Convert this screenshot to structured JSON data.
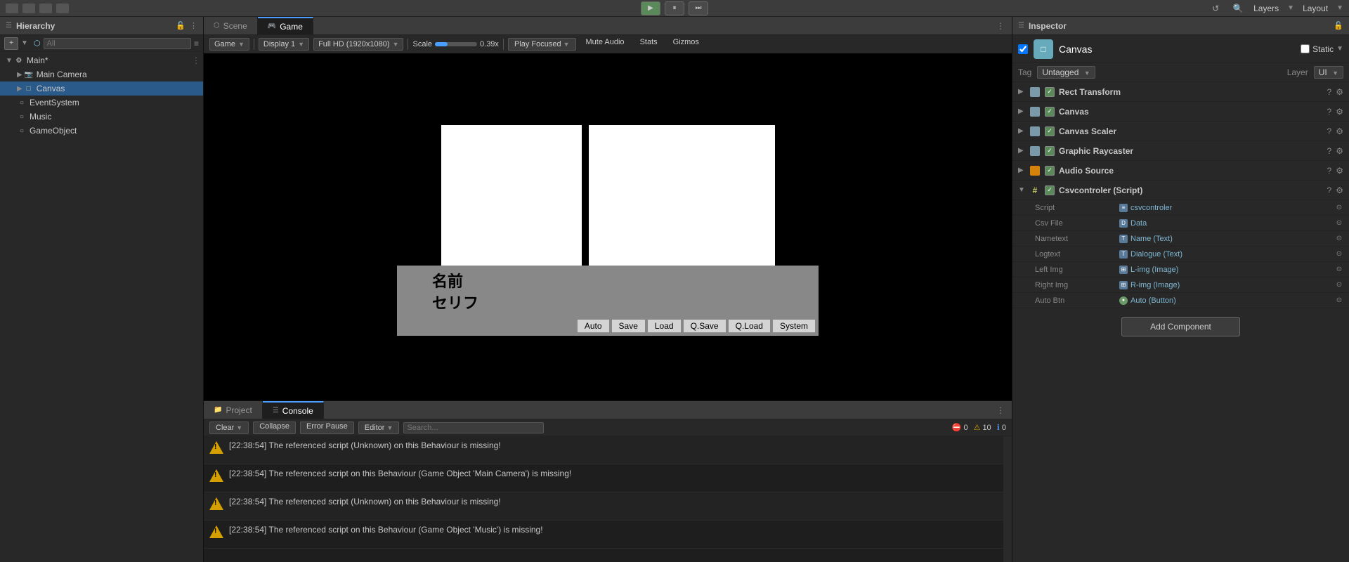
{
  "topbar": {
    "layers_label": "Layers",
    "layout_label": "Layout"
  },
  "playctrls": {
    "play": "▶",
    "pause": "⏸",
    "step": "⏭"
  },
  "hierarchy": {
    "title": "Hierarchy",
    "search_placeholder": "All",
    "root_name": "Main*",
    "items": [
      {
        "label": "Main Camera",
        "type": "camera",
        "depth": 1
      },
      {
        "label": "Canvas",
        "type": "canvas",
        "depth": 1
      },
      {
        "label": "EventSystem",
        "type": "obj",
        "depth": 1
      },
      {
        "label": "Music",
        "type": "obj",
        "depth": 1
      },
      {
        "label": "GameObject",
        "type": "obj",
        "depth": 1
      }
    ]
  },
  "scene_tabs": [
    {
      "label": "Scene",
      "active": false
    },
    {
      "label": "Game",
      "active": true
    }
  ],
  "game_toolbar": {
    "game_label": "Game",
    "display_label": "Display 1",
    "resolution_label": "Full HD (1920x1080)",
    "scale_label": "Scale",
    "scale_value": "0.39x",
    "play_focused_label": "Play Focused",
    "mute_audio_label": "Mute Audio",
    "stats_label": "Stats",
    "gizmos_label": "Gizmos"
  },
  "game_viewport": {
    "dialog_name": "名前",
    "dialog_serif": "セリフ",
    "buttons": [
      "Auto",
      "Save",
      "Load",
      "Q.Save",
      "Q.Load",
      "System"
    ]
  },
  "console": {
    "project_tab": "Project",
    "console_tab": "Console",
    "clear_label": "Clear",
    "collapse_label": "Collapse",
    "error_pause_label": "Error Pause",
    "editor_label": "Editor",
    "error_count": "0",
    "warning_count": "10",
    "info_count": "0",
    "messages": [
      {
        "text": "[22:38:54] The referenced script (Unknown) on this Behaviour is missing!"
      },
      {
        "text": "[22:38:54] The referenced script on this Behaviour (Game Object 'Main Camera') is missing!"
      },
      {
        "text": "[22:38:54] The referenced script (Unknown) on this Behaviour is missing!"
      },
      {
        "text": "[22:38:54] The referenced script on this Behaviour (Game Object 'Music') is missing!"
      }
    ]
  },
  "inspector": {
    "title": "Inspector",
    "object_name": "Canvas",
    "static_label": "Static",
    "tag_label": "Tag",
    "tag_value": "Untagged",
    "layer_label": "Layer",
    "layer_value": "UI",
    "components": [
      {
        "name": "Rect Transform",
        "checked": true,
        "icon": "rect"
      },
      {
        "name": "Canvas",
        "checked": true,
        "icon": "rect"
      },
      {
        "name": "Canvas Scaler",
        "checked": true,
        "icon": "rect"
      },
      {
        "name": "Graphic Raycaster",
        "checked": true,
        "icon": "rect"
      },
      {
        "name": "Audio Source",
        "checked": true,
        "icon": "orange"
      },
      {
        "name": "Csvcontroler (Script)",
        "checked": true,
        "icon": "hashtag"
      }
    ],
    "script_fields": [
      {
        "label": "Script",
        "value": "csvcontroler",
        "icon": "script"
      },
      {
        "label": "Csv File",
        "value": "Data",
        "icon": "file"
      },
      {
        "label": "Nametext",
        "value": "Name (Text)",
        "icon": "text"
      },
      {
        "label": "Logtext",
        "value": "Dialogue (Text)",
        "icon": "text"
      },
      {
        "label": "Left Img",
        "value": "L-img (Image)",
        "icon": "image"
      },
      {
        "label": "Right Img",
        "value": "R-img (Image)",
        "icon": "image"
      },
      {
        "label": "Auto Btn",
        "value": "Auto (Button)",
        "icon": "button"
      }
    ],
    "add_component_label": "Add Component"
  }
}
